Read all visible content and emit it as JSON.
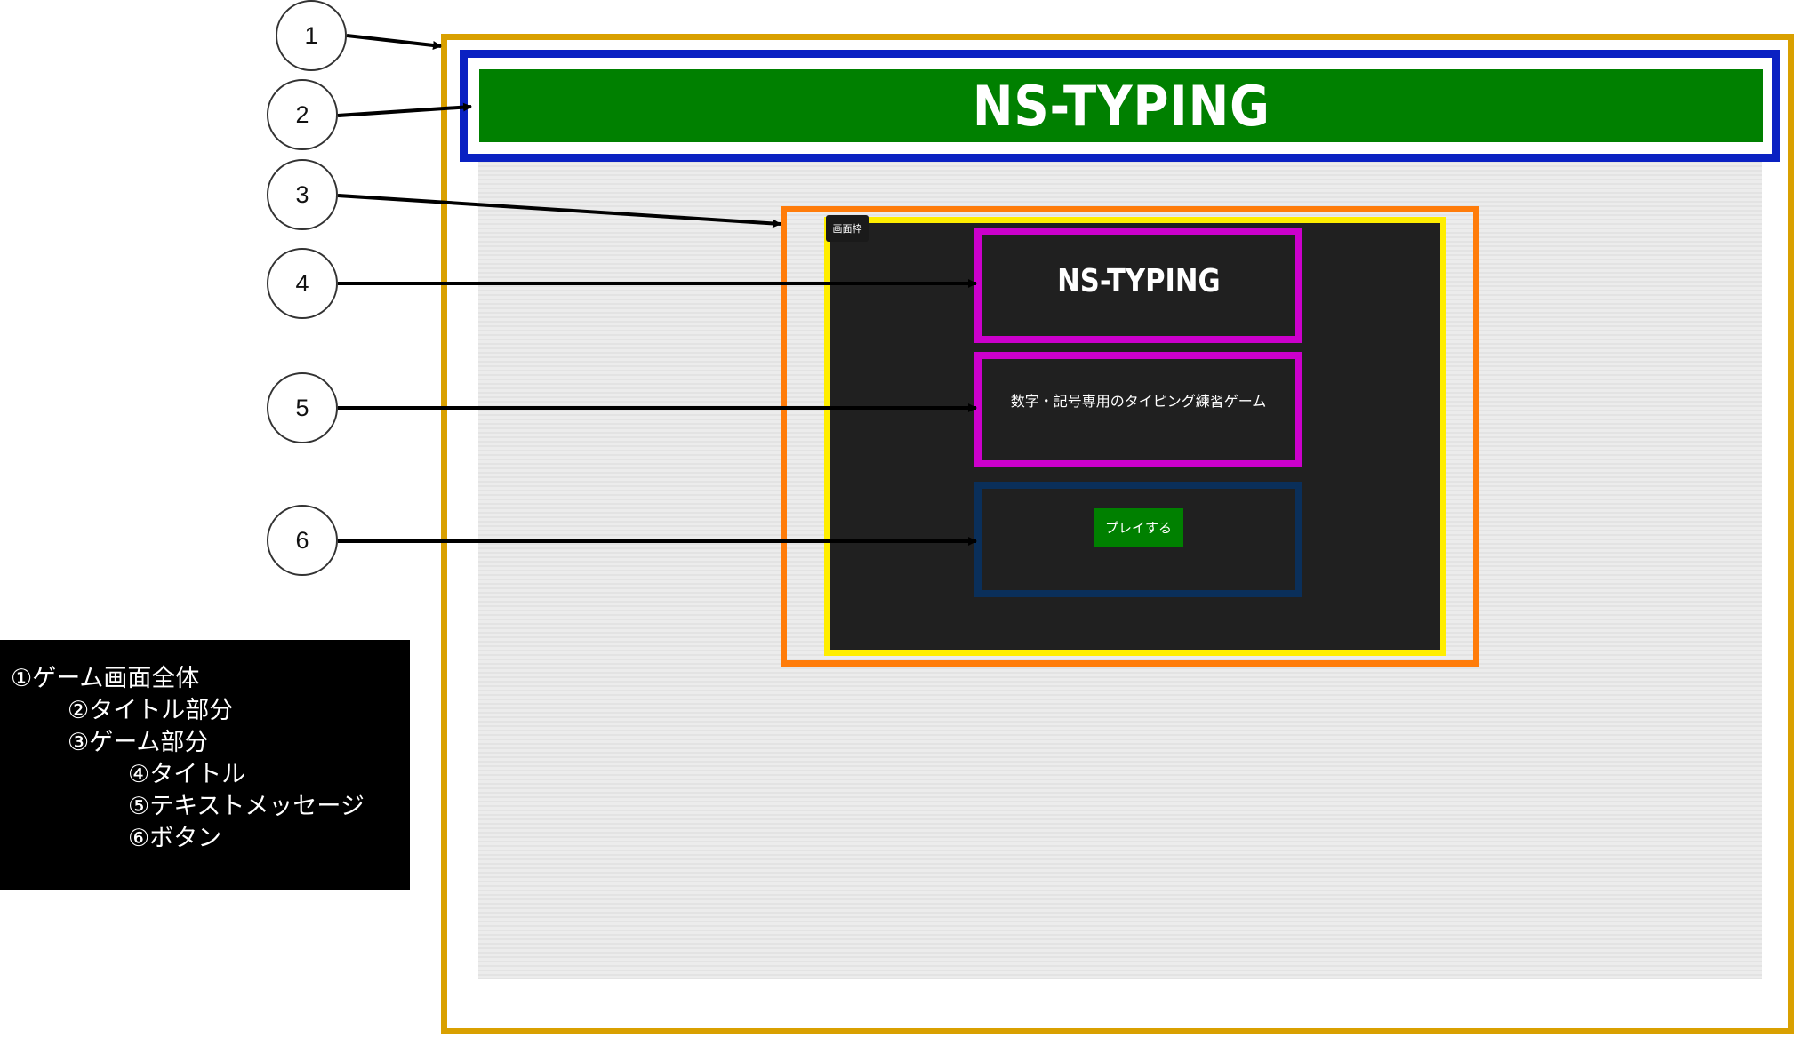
{
  "callouts": [
    "1",
    "2",
    "3",
    "4",
    "5",
    "6"
  ],
  "header": {
    "title": "NS-TYPING"
  },
  "screen": {
    "label": "画面枠",
    "title": "NS-TYPING",
    "message": "数字・記号専用のタイピング練習ゲーム",
    "play_button": "プレイする"
  },
  "legend": {
    "items": [
      "①ゲーム画面全体",
      "②タイトル部分",
      "③ゲーム部分",
      "④タイトル",
      "⑤テキストメッセージ",
      "⑥ボタン"
    ]
  },
  "colors": {
    "frame_game": "#d9a000",
    "frame_title": "#0a21c2",
    "frame_section": "#ff7c0a",
    "screen_border": "#ffee00",
    "box_title": "#cc00cc",
    "box_message": "#cc00cc",
    "box_button": "#0a2f5a",
    "title_bar": "#008000",
    "button": "#008000",
    "screen_bg": "#202020"
  }
}
